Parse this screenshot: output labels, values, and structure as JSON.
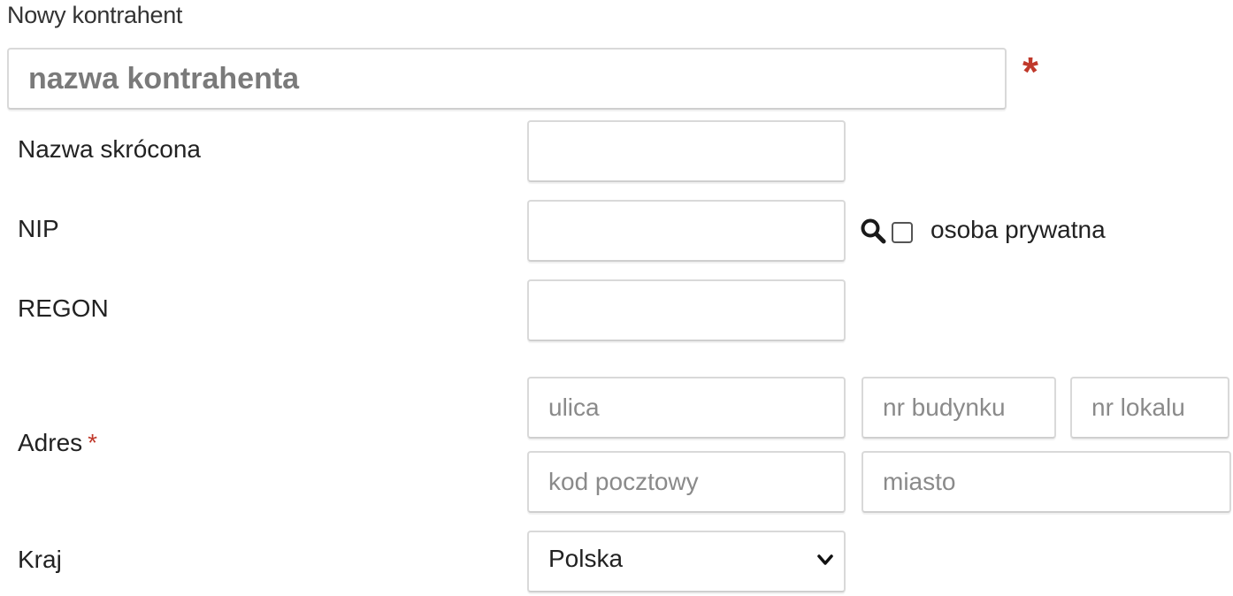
{
  "header": {
    "title": "Nowy kontrahent"
  },
  "name_field": {
    "placeholder": "nazwa kontrahenta",
    "value": "",
    "required_mark": "*"
  },
  "short_name": {
    "label": "Nazwa skrócona",
    "value": ""
  },
  "nip": {
    "label": "NIP",
    "value": "",
    "search_icon": "search-icon",
    "private_person_label": "osoba prywatna",
    "private_person_checked": false
  },
  "regon": {
    "label": "REGON",
    "value": ""
  },
  "address": {
    "label": "Adres",
    "required_mark": "*",
    "street_placeholder": "ulica",
    "building_placeholder": "nr budynku",
    "apartment_placeholder": "nr lokalu",
    "postal_code_placeholder": "kod pocztowy",
    "city_placeholder": "miasto"
  },
  "country": {
    "label": "Kraj",
    "selected": "Polska",
    "icon": "chevron-down-icon"
  },
  "colors": {
    "required": "#c0392b",
    "border": "#d9d9d9",
    "text": "#222222",
    "placeholder": "#8a8a8a"
  }
}
